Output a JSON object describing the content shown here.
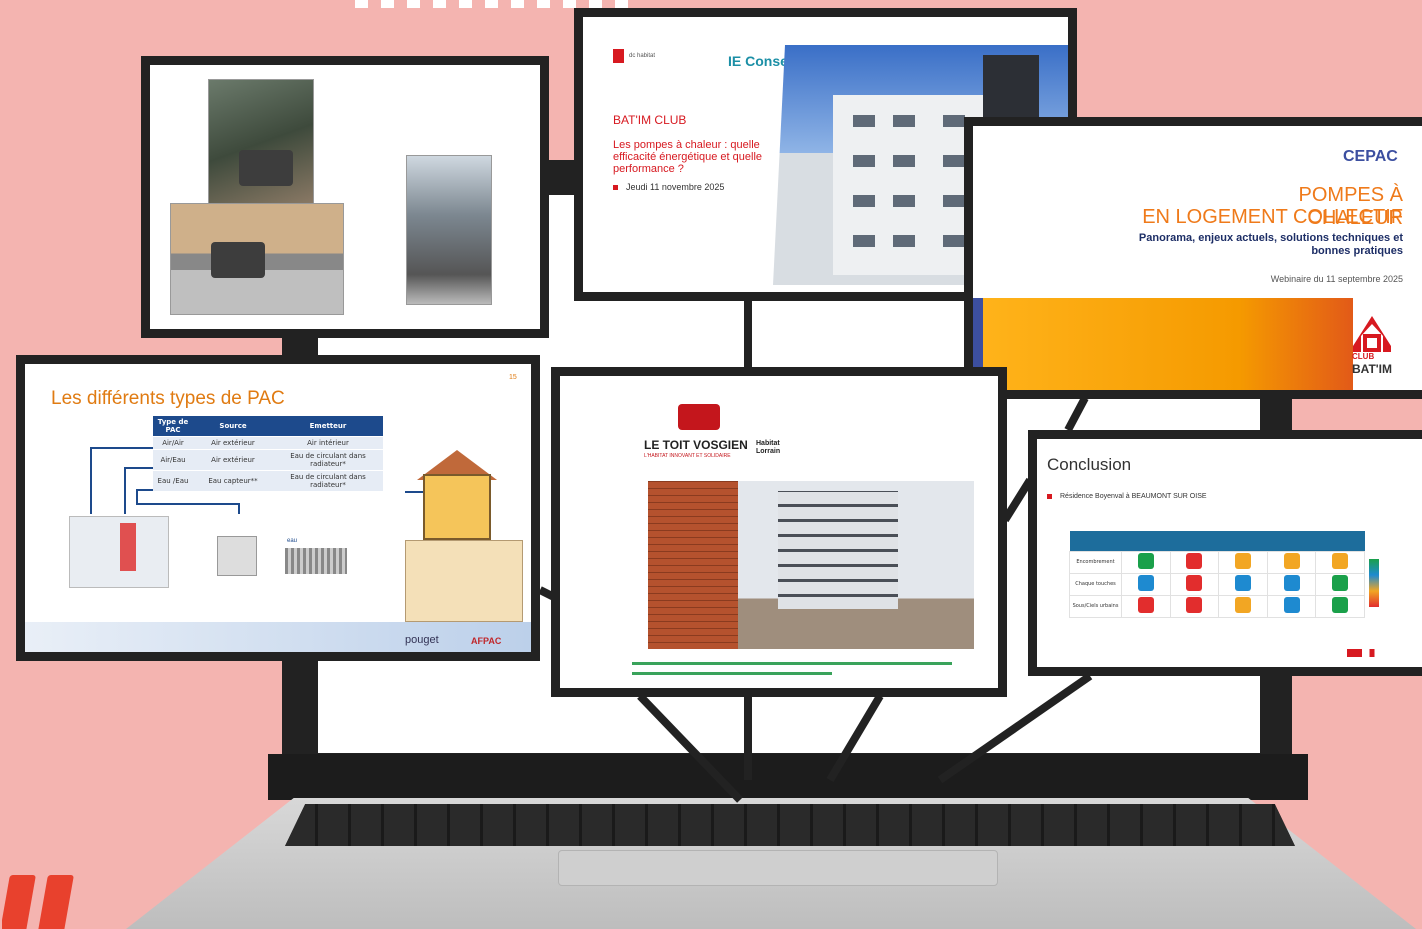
{
  "colors": {
    "background": "#f4b4b0",
    "accent_red": "#e8412d",
    "navy": "#1d4a8c"
  },
  "card_batim": {
    "logo_left": "dc habitat",
    "logo_right": "IE Conseil",
    "club": "BAT'IM CLUB",
    "title": "Les pompes à chaleur : quelle efficacité énergétique et quelle performance ?",
    "date": "Jeudi 11 novembre 2025"
  },
  "card_cepac": {
    "logo": "CEPAC",
    "title_line1": "POMPES À CHALEUR",
    "title_line2": "EN LOGEMENT COLLECTIF",
    "subtitle": "Panorama, enjeux actuels, solutions techniques et bonnes pratiques",
    "webinar": "Webinaire du 11 septembre 2025",
    "club_label": "CLUB",
    "batim_label": "BAT'IM"
  },
  "card_pac": {
    "title": "Les différents types de PAC",
    "page_number": "15",
    "table": {
      "headers": [
        "Type de PAC",
        "Source",
        "Emetteur"
      ],
      "rows": [
        [
          "Air/Air",
          "Air extérieur",
          "Air intérieur"
        ],
        [
          "Air/Eau",
          "Air extérieur",
          "Eau de circulant dans radiateur*"
        ],
        [
          "Eau /Eau",
          "Eau capteur**",
          "Eau de circulant dans radiateur*"
        ]
      ]
    },
    "water_label": "eau",
    "brand1": "pouget",
    "brand2": "AFPAC"
  },
  "card_toit": {
    "name": "LE TOIT VOSGIEN",
    "tagline": "L'HABITAT INNOVANT ET SOLIDAIRE",
    "partner": "Habitat Lorrain"
  },
  "card_conclusion": {
    "title": "Conclusion",
    "bullet": "Résidence Boyenval à BEAUMONT SUR OISE",
    "rows": [
      {
        "label": "Encombrement",
        "cells": [
          "#1aa04a",
          "#e22d2d",
          "#f2a623",
          "#f2a623",
          "#f2a623"
        ]
      },
      {
        "label": "Chaque touches",
        "cells": [
          "#1e8ad0",
          "#e22d2d",
          "#1e8ad0",
          "#1e8ad0",
          "#1aa04a"
        ]
      },
      {
        "label": "Sous/Ciels urbains",
        "cells": [
          "#e22d2d",
          "#e22d2d",
          "#f2a623",
          "#1e8ad0",
          "#1aa04a"
        ]
      }
    ]
  }
}
